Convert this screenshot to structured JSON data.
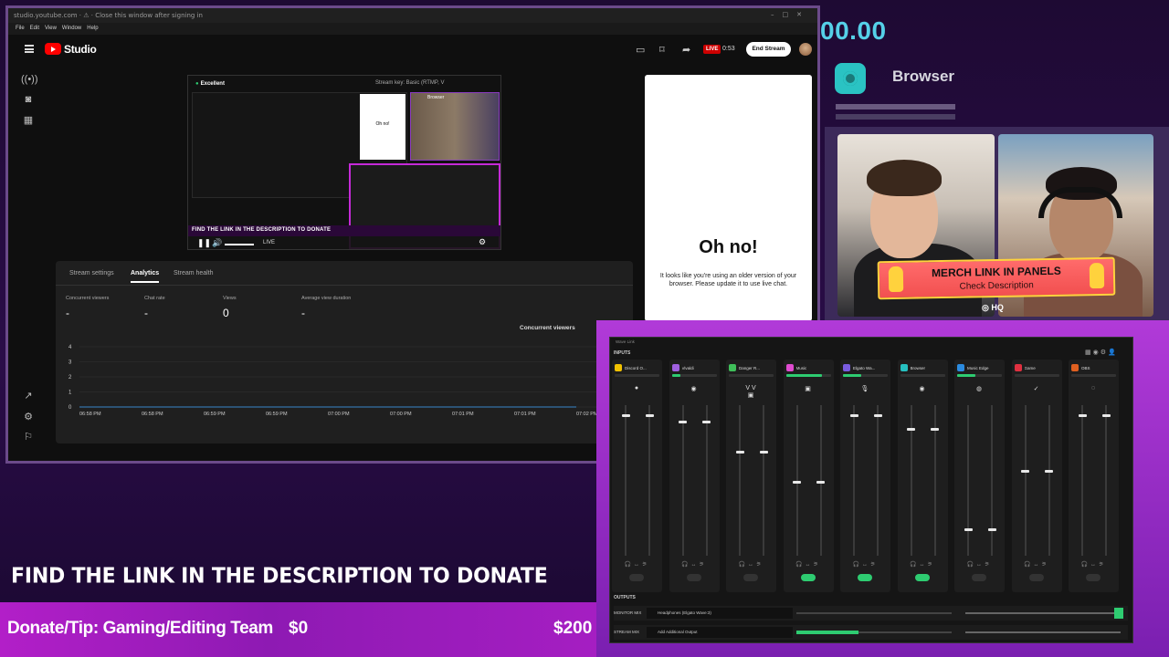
{
  "yt": {
    "url": "studio.youtube.com  ·  ⚠  ·  Close this window after signing in",
    "menu": [
      "File",
      "Edit",
      "View",
      "Window",
      "Help"
    ],
    "studio": "Studio",
    "live_badge": "LIVE",
    "live_time": "0:53",
    "end_stream": "End Stream",
    "preview": {
      "quality": "Excellent",
      "stream_key": "Stream key: Basic (RTMP, V",
      "inner_browser": "Browser",
      "inner_oh_no": "Oh no!",
      "banner": "FIND THE LINK IN THE DESCRIPTION TO DONATE",
      "live": "LIVE"
    },
    "chat": {
      "title": "Oh no!",
      "message": "It looks like you're using an older version of your browser. Please update it to use live chat."
    },
    "tabs": [
      "Stream settings",
      "Analytics",
      "Stream health"
    ],
    "metrics": [
      {
        "label": "Concurrent viewers",
        "value": "-"
      },
      {
        "label": "Chat rate",
        "value": "-"
      },
      {
        "label": "Views",
        "value": "0"
      },
      {
        "label": "Average view duration",
        "value": "-"
      }
    ],
    "concurrent_label": "Concurrent viewers"
  },
  "chart_data": {
    "type": "line",
    "x": [
      "06:58 PM",
      "06:58 PM",
      "06:59 PM",
      "06:59 PM",
      "07:00 PM",
      "07:00 PM",
      "07:01 PM",
      "07:01 PM",
      "07:02 PM"
    ],
    "series": [
      {
        "values": [
          0,
          0,
          0,
          0,
          0,
          0,
          0,
          0,
          0
        ]
      }
    ],
    "yticks": [
      0,
      1,
      2,
      3,
      4
    ],
    "ylim": [
      0,
      4
    ],
    "title": "",
    "xlabel": "",
    "ylabel": "",
    "grid": true
  },
  "overlay": {
    "timer": "00.00",
    "browser_title": "Browser",
    "merch_title": "MERCH LINK IN PANELS",
    "merch_sub": "Check Description",
    "hq": "HQ",
    "find_link": "FIND THE LINK IN THE DESCRIPTION TO DONATE",
    "donate_label": "Donate/Tip: Gaming/Editing Team",
    "donate_min": "$0",
    "donate_max": "$200"
  },
  "mixer": {
    "title": "Wave Link",
    "inputs_label": "INPUTS",
    "outputs_label": "OUTPUTS",
    "channels": [
      {
        "name": "Discord O...",
        "color": "#f2c200",
        "level": 0.0,
        "fader": 0.06,
        "icon": "●",
        "monitor_on": false
      },
      {
        "name": "Vivaldi",
        "color": "#a060e0",
        "level": 0.2,
        "fader": 0.1,
        "icon": "◉",
        "monitor_on": false
      },
      {
        "name": "Danger R...",
        "color": "#3fbf5a",
        "level": 0.0,
        "fader": 0.3,
        "icon": "V V ▣",
        "monitor_on": false
      },
      {
        "name": "Music",
        "color": "#e04bd0",
        "level": 0.8,
        "fader": 0.5,
        "icon": "▣",
        "monitor_on": true
      },
      {
        "name": "Elgato Wa...",
        "color": "#7a5ce0",
        "level": 0.4,
        "fader": 0.06,
        "icon": "🎙",
        "monitor_on": true
      },
      {
        "name": "Browser",
        "color": "#26c0c0",
        "level": 0.0,
        "fader": 0.15,
        "icon": "◉",
        "monitor_on": true
      },
      {
        "name": "Music Edge",
        "color": "#2b8be0",
        "level": 0.4,
        "fader": 0.82,
        "icon": "◍",
        "monitor_on": false
      },
      {
        "name": "Game",
        "color": "#e03040",
        "level": 0.0,
        "fader": 0.43,
        "icon": "✓",
        "monitor_on": false
      },
      {
        "name": "OBS",
        "color": "#e06020",
        "level": 0.0,
        "fader": 0.06,
        "icon": "◌",
        "monitor_on": false
      }
    ],
    "outputs": [
      {
        "label": "MONITOR MIX",
        "device": "Headphones (Elgato Wave:3)",
        "level": 0.0
      },
      {
        "label": "STREAM MIX",
        "device": "Add Additional Output",
        "level": 0.4
      }
    ]
  }
}
